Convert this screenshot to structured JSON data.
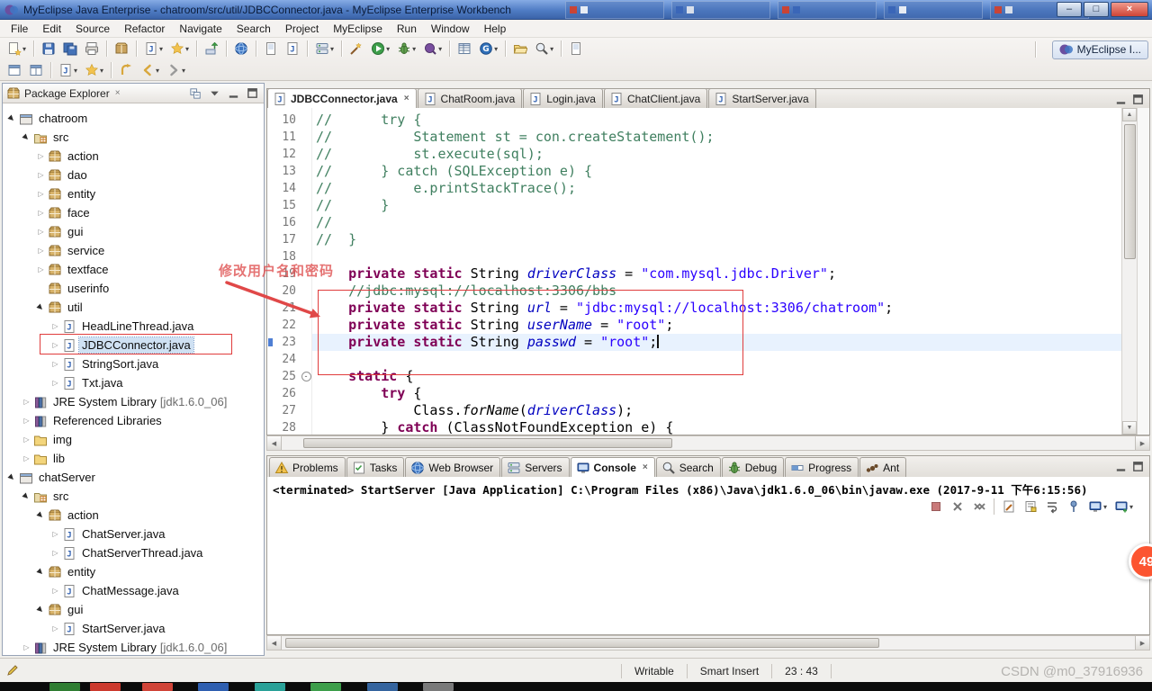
{
  "window": {
    "title": "MyEclipse Java Enterprise - chatroom/src/util/JDBCConnector.java - MyEclipse Enterprise Workbench"
  },
  "glyphs": {
    "minimize": "–",
    "maximize": "□",
    "close": "×",
    "tab_close": "×",
    "dropdown": "▾",
    "scroll_up": "▲",
    "scroll_down": "▼",
    "scroll_left": "◀",
    "scroll_right": "▶",
    "fold_collapse": "-"
  },
  "menu": {
    "items": [
      "File",
      "Edit",
      "Source",
      "Refactor",
      "Navigate",
      "Search",
      "Project",
      "MyEclipse",
      "Run",
      "Window",
      "Help"
    ]
  },
  "toolbar": {
    "perspective": {
      "label": "MyEclipse I..."
    },
    "row1": [
      {
        "name": "new-wizard",
        "icon": "newwiz",
        "dd": true
      },
      "|",
      {
        "name": "save",
        "icon": "save"
      },
      {
        "name": "save-all",
        "icon": "saveall"
      },
      {
        "name": "print",
        "icon": "print"
      },
      "|",
      {
        "name": "export-archive",
        "icon": "package"
      },
      "|",
      {
        "name": "new-java-project",
        "icon": "jproj",
        "dd": true
      },
      {
        "name": "new-wizards",
        "icon": "star",
        "dd": true
      },
      "|",
      {
        "name": "deploy-module",
        "icon": "deploy"
      },
      "|",
      {
        "name": "web-browser",
        "icon": "globe"
      },
      "|",
      {
        "name": "new-html-page",
        "icon": "page"
      },
      {
        "name": "new-jsp",
        "icon": "pagej"
      },
      "|",
      {
        "name": "run-server",
        "icon": "server",
        "dd": true
      },
      "|",
      {
        "name": "validate",
        "icon": "wand"
      },
      {
        "name": "run",
        "icon": "play",
        "dd": true
      },
      {
        "name": "debug",
        "icon": "bug",
        "dd": true
      },
      {
        "name": "profile",
        "icon": "profile",
        "dd": true
      },
      "|",
      {
        "name": "database-explorer",
        "icon": "grid"
      },
      {
        "name": "genuitec",
        "icon": "gbtn",
        "dd": true
      },
      "|",
      {
        "name": "open-resource",
        "icon": "folderopen"
      },
      {
        "name": "search",
        "icon": "searchi",
        "dd": true
      },
      "|",
      {
        "name": "annotations",
        "icon": "page"
      }
    ],
    "row2": [
      {
        "name": "editor-window",
        "icon": "window"
      },
      {
        "name": "split-editor",
        "icon": "window2"
      },
      "|",
      {
        "name": "new-java-class",
        "icon": "pagej",
        "dd": true
      },
      {
        "name": "new-wizard-menu",
        "icon": "star",
        "dd": true
      },
      "|",
      {
        "name": "last-edit-location",
        "icon": "lastedit"
      },
      {
        "name": "back",
        "icon": "back",
        "dd": true
      },
      {
        "name": "forward",
        "icon": "forward",
        "dd": true
      }
    ]
  },
  "package_explorer": {
    "title": "Package Explorer",
    "tree": [
      {
        "label": "chatroom",
        "level": 0,
        "icon": "project",
        "arrow": "exp"
      },
      {
        "label": "src",
        "level": 1,
        "icon": "src",
        "arrow": "exp"
      },
      {
        "label": "action",
        "level": 2,
        "icon": "pkg",
        "arrow": "col"
      },
      {
        "label": "dao",
        "level": 2,
        "icon": "pkg",
        "arrow": "col"
      },
      {
        "label": "entity",
        "level": 2,
        "icon": "pkg",
        "arrow": "col"
      },
      {
        "label": "face",
        "level": 2,
        "icon": "pkg",
        "arrow": "col"
      },
      {
        "label": "gui",
        "level": 2,
        "icon": "pkg",
        "arrow": "col"
      },
      {
        "label": "service",
        "level": 2,
        "icon": "pkg",
        "arrow": "col"
      },
      {
        "label": "textface",
        "level": 2,
        "icon": "pkg",
        "arrow": "col"
      },
      {
        "label": "userinfo",
        "level": 2,
        "icon": "pkg",
        "arrow": "none"
      },
      {
        "label": "util",
        "level": 2,
        "icon": "pkg",
        "arrow": "exp"
      },
      {
        "label": "HeadLineThread.java",
        "level": 3,
        "icon": "pagej",
        "arrow": "col"
      },
      {
        "label": "JDBCConnector.java",
        "level": 3,
        "icon": "pagej",
        "arrow": "col",
        "selected": true
      },
      {
        "label": "StringSort.java",
        "level": 3,
        "icon": "pagej",
        "arrow": "col"
      },
      {
        "label": "Txt.java",
        "level": 3,
        "icon": "pagej",
        "arrow": "col"
      },
      {
        "label": "JRE System Library",
        "deco": " [jdk1.6.0_06]",
        "level": 1,
        "icon": "lib",
        "arrow": "col"
      },
      {
        "label": "Referenced Libraries",
        "level": 1,
        "icon": "lib",
        "arrow": "col"
      },
      {
        "label": "img",
        "level": 1,
        "icon": "folder",
        "arrow": "col"
      },
      {
        "label": "lib",
        "level": 1,
        "icon": "folder",
        "arrow": "col"
      },
      {
        "label": "chatServer",
        "level": 0,
        "icon": "project",
        "arrow": "exp"
      },
      {
        "label": "src",
        "level": 1,
        "icon": "src",
        "arrow": "exp"
      },
      {
        "label": "action",
        "level": 2,
        "icon": "pkg",
        "arrow": "exp"
      },
      {
        "label": "ChatServer.java",
        "level": 3,
        "icon": "pagej",
        "arrow": "col"
      },
      {
        "label": "ChatServerThread.java",
        "level": 3,
        "icon": "pagej",
        "arrow": "col"
      },
      {
        "label": "entity",
        "level": 2,
        "icon": "pkg",
        "arrow": "exp"
      },
      {
        "label": "ChatMessage.java",
        "level": 3,
        "icon": "pagej",
        "arrow": "col"
      },
      {
        "label": "gui",
        "level": 2,
        "icon": "pkg",
        "arrow": "exp"
      },
      {
        "label": "StartServer.java",
        "level": 3,
        "icon": "pagej",
        "arrow": "col"
      },
      {
        "label": "JRE System Library",
        "deco": " [jdk1.6.0_06]",
        "level": 1,
        "icon": "lib",
        "arrow": "col"
      }
    ]
  },
  "editor": {
    "tabs": [
      {
        "label": "JDBCConnector.java",
        "active": true
      },
      {
        "label": "ChatRoom.java"
      },
      {
        "label": "Login.java"
      },
      {
        "label": "ChatClient.java"
      },
      {
        "label": "StartServer.java"
      }
    ],
    "annotation_overlay": {
      "note": "修改用户名和密码"
    },
    "code": {
      "lines": [
        {
          "n": 10,
          "t": [
            [
              "c",
              "//      try {"
            ]
          ]
        },
        {
          "n": 11,
          "t": [
            [
              "c",
              "//          Statement st = con.createStatement();"
            ]
          ]
        },
        {
          "n": 12,
          "t": [
            [
              "c",
              "//          st.execute(sql);"
            ]
          ]
        },
        {
          "n": 13,
          "t": [
            [
              "c",
              "//      } catch (SQLException e) {"
            ]
          ]
        },
        {
          "n": 14,
          "t": [
            [
              "c",
              "//          e.printStackTrace();"
            ]
          ]
        },
        {
          "n": 15,
          "t": [
            [
              "c",
              "//      }"
            ]
          ]
        },
        {
          "n": 16,
          "t": [
            [
              "c",
              "//"
            ]
          ]
        },
        {
          "n": 17,
          "t": [
            [
              "c",
              "//  }"
            ]
          ]
        },
        {
          "n": 18,
          "t": []
        },
        {
          "n": 19,
          "t": [
            [
              "p",
              "    "
            ],
            [
              "k",
              "private"
            ],
            [
              "p",
              " "
            ],
            [
              "k",
              "static"
            ],
            [
              "p",
              " String "
            ],
            [
              "f",
              "driverClass"
            ],
            [
              "p",
              " = "
            ],
            [
              "s",
              "\"com.mysql.jdbc.Driver\""
            ],
            [
              "p",
              ";"
            ]
          ]
        },
        {
          "n": 20,
          "t": [
            [
              "p",
              "    "
            ],
            [
              "c",
              "//jdbc:mysql://localhost:3306/bbs"
            ]
          ]
        },
        {
          "n": 21,
          "t": [
            [
              "p",
              "    "
            ],
            [
              "k",
              "private"
            ],
            [
              "p",
              " "
            ],
            [
              "k",
              "static"
            ],
            [
              "p",
              " String "
            ],
            [
              "f",
              "url"
            ],
            [
              "p",
              " = "
            ],
            [
              "s",
              "\"jdbc:mysql://localhost:3306/chatroom\""
            ],
            [
              "p",
              ";"
            ]
          ]
        },
        {
          "n": 22,
          "t": [
            [
              "p",
              "    "
            ],
            [
              "k",
              "private"
            ],
            [
              "p",
              " "
            ],
            [
              "k",
              "static"
            ],
            [
              "p",
              " String "
            ],
            [
              "f",
              "userName"
            ],
            [
              "p",
              " = "
            ],
            [
              "s",
              "\"root\""
            ],
            [
              "p",
              ";"
            ]
          ]
        },
        {
          "n": 23,
          "t": [
            [
              "p",
              "    "
            ],
            [
              "k",
              "private"
            ],
            [
              "p",
              " "
            ],
            [
              "k",
              "static"
            ],
            [
              "p",
              " String "
            ],
            [
              "f",
              "passwd"
            ],
            [
              "p",
              " = "
            ],
            [
              "s",
              "\"root\""
            ],
            [
              "p",
              ";"
            ]
          ],
          "cur": true,
          "caret": true
        },
        {
          "n": 24,
          "t": []
        },
        {
          "n": 25,
          "t": [
            [
              "p",
              "    "
            ],
            [
              "k",
              "static"
            ],
            [
              "p",
              " {"
            ]
          ],
          "fold": true
        },
        {
          "n": 26,
          "t": [
            [
              "p",
              "        "
            ],
            [
              "k",
              "try"
            ],
            [
              "p",
              " {"
            ]
          ]
        },
        {
          "n": 27,
          "t": [
            [
              "p",
              "            Class."
            ],
            [
              "m",
              "forName"
            ],
            [
              "p",
              "("
            ],
            [
              "f",
              "driverClass"
            ],
            [
              "p",
              ");"
            ]
          ]
        },
        {
          "n": 28,
          "t": [
            [
              "p",
              "        } "
            ],
            [
              "k",
              "catch"
            ],
            [
              "p",
              " (ClassNotFoundException e) {"
            ]
          ]
        }
      ]
    }
  },
  "console": {
    "tabs": [
      {
        "label": "Problems",
        "icon": "problems"
      },
      {
        "label": "Tasks",
        "icon": "tasks"
      },
      {
        "label": "Web Browser",
        "icon": "globe"
      },
      {
        "label": "Servers",
        "icon": "server"
      },
      {
        "label": "Console",
        "icon": "monitor",
        "active": true
      },
      {
        "label": "Search",
        "icon": "searchi"
      },
      {
        "label": "Debug",
        "icon": "bug"
      },
      {
        "label": "Progress",
        "icon": "progress"
      },
      {
        "label": "Ant",
        "icon": "ant"
      }
    ],
    "message": "<terminated> StartServer [Java Application] C:\\Program Files (x86)\\Java\\jdk1.6.0_06\\bin\\javaw.exe (2017-9-11 下午6:15:56)",
    "toolbar": [
      {
        "name": "terminate",
        "icon": "terminate"
      },
      {
        "name": "remove-launch",
        "icon": "xgray"
      },
      {
        "name": "remove-all-launches",
        "icon": "xxgray"
      },
      "|",
      {
        "name": "clear-console",
        "icon": "clearcon"
      },
      {
        "name": "scroll-lock",
        "icon": "scrolllock"
      },
      {
        "name": "word-wrap",
        "icon": "wordwrap"
      },
      {
        "name": "pin-console",
        "icon": "pin"
      },
      {
        "name": "display-selected-console",
        "icon": "monitor",
        "dd": true
      },
      {
        "name": "open-console",
        "icon": "monitorplus",
        "dd": true
      }
    ]
  },
  "status_bar": {
    "writable": "Writable",
    "insert_mode": "Smart Insert",
    "cursor_position": "23 : 43"
  },
  "overlays": {
    "watermark": "CSDN @m0_37916936",
    "badge": "49"
  }
}
